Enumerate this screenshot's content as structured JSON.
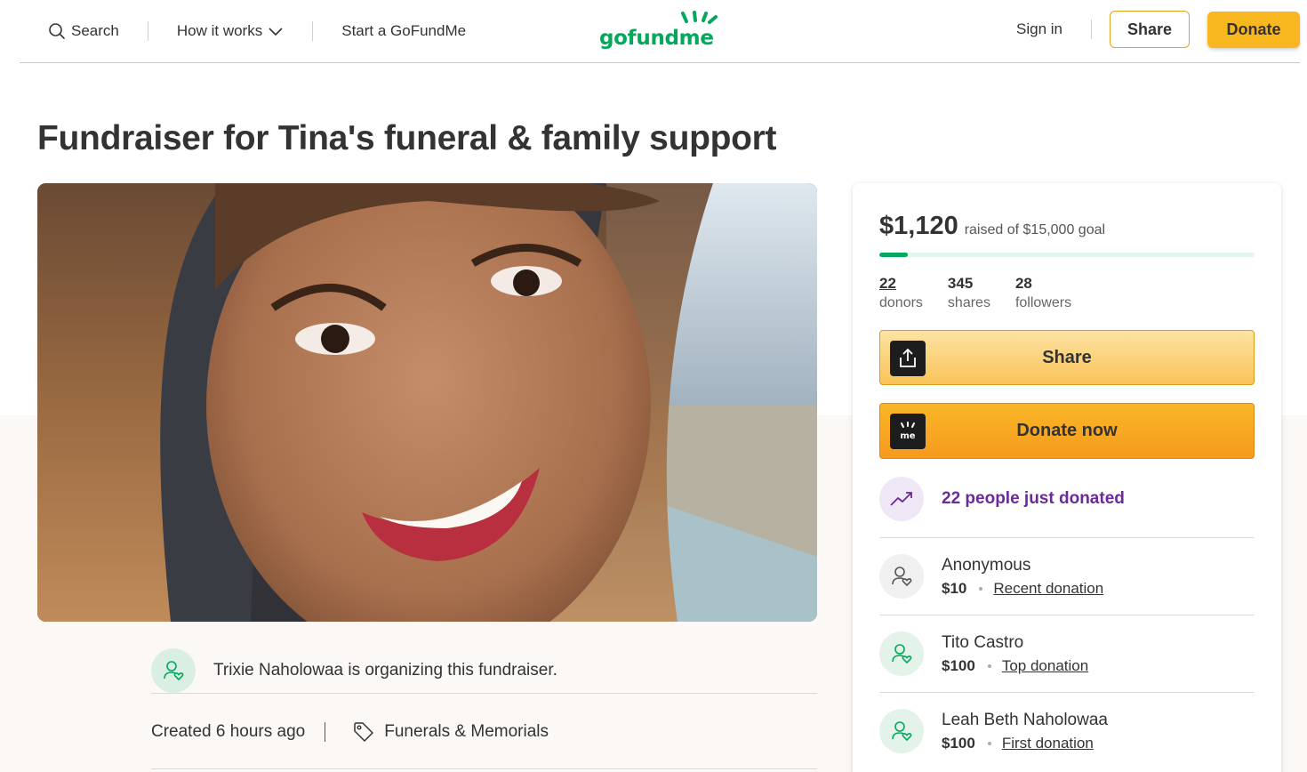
{
  "nav": {
    "search_label": "Search",
    "how_label": "How it works",
    "start_label": "Start a GoFundMe",
    "logo_text": "gofundme",
    "signin_label": "Sign in",
    "share_label": "Share",
    "donate_label": "Donate"
  },
  "page": {
    "title": "Fundraiser for Tina's funeral & family support"
  },
  "organizer": {
    "text": "Trixie Naholowaa is organizing this fundraiser.",
    "created": "Created 6 hours ago",
    "category": "Funerals & Memorials"
  },
  "sidebar": {
    "raised_amount": "$1,120",
    "goal_text": "raised of $15,000 goal",
    "progress_fraction": 0.075,
    "stats": [
      {
        "num": "22",
        "label": "donors"
      },
      {
        "num": "345",
        "label": "shares"
      },
      {
        "num": "28",
        "label": "followers"
      }
    ],
    "share_button": "Share",
    "donate_button": "Donate now",
    "trend_text": "22 people just donated",
    "donors": [
      {
        "name": "Anonymous",
        "amount": "$10",
        "tag": "Recent donation"
      },
      {
        "name": "Tito Castro",
        "amount": "$100",
        "tag": "Top donation"
      },
      {
        "name": "Leah Beth Naholowaa",
        "amount": "$100",
        "tag": "First donation"
      }
    ]
  },
  "colors": {
    "brand_green": "#02a95c",
    "donate_yellow": "#f8b71e",
    "trend_purple": "#6b2a98"
  }
}
